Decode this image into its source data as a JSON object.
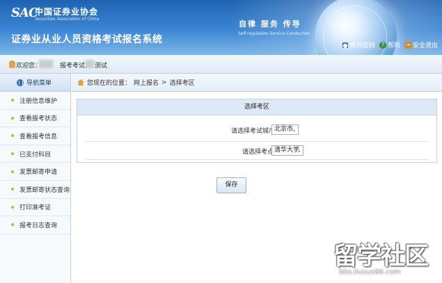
{
  "header": {
    "logo_mark": "SAC",
    "logo_cn": "中国证券业协会",
    "logo_en": "Securities Association of China",
    "system_title": "证券业从业人员资格考试报名系统",
    "slogan_cn": "自律  服务  传导",
    "slogan_en": "Self-regulation   Service   Conduction",
    "links": {
      "change_password": "修改密码",
      "help": "帮助",
      "logout": "安全退出"
    },
    "colors": {
      "top": "#1f63b2",
      "bottom": "#7fb6e8"
    }
  },
  "infobar": {
    "welcome_label": "欢迎您：",
    "exam_label": "报考考试：",
    "exam_name_visible": "测试"
  },
  "sidebar": {
    "title": "导航菜单",
    "items": [
      {
        "label": "注册信息维护"
      },
      {
        "label": "查看报考状态"
      },
      {
        "label": "查看报考信息"
      },
      {
        "label": "已支付科目"
      },
      {
        "label": "发票邮寄申请"
      },
      {
        "label": "发票邮寄状态查询"
      },
      {
        "label": "打印准考证"
      },
      {
        "label": "报考日志查询"
      }
    ]
  },
  "breadcrumb": {
    "prefix": "您现在的位置：",
    "path1": "网上报名",
    "separator": ">",
    "path2": "选择考区"
  },
  "form": {
    "title": "选择考区",
    "city_label": "请选择考试城市",
    "city_value": "北京市",
    "site_label": "请选择考点",
    "site_value": "清华大学",
    "save_label": "保存"
  },
  "watermark": {
    "text": "留学社区",
    "url": "bbs.liuxue86.com"
  }
}
